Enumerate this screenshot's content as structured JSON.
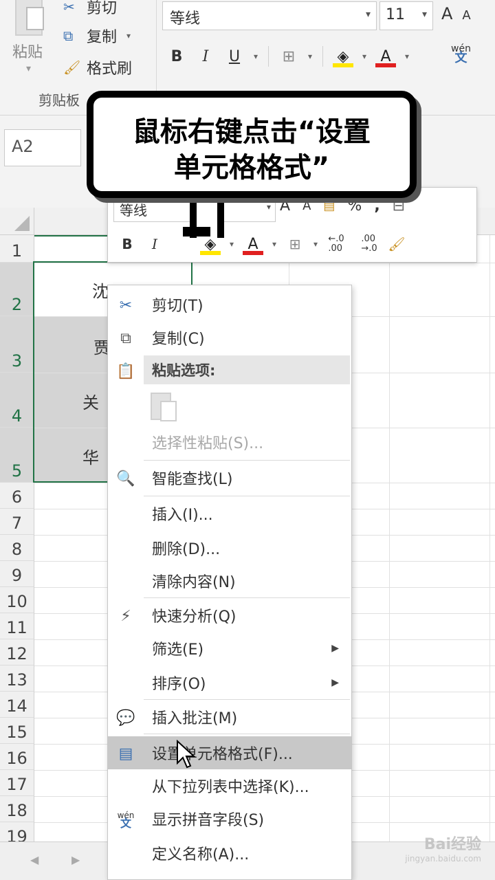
{
  "ribbon": {
    "paste_label": "粘贴",
    "cut_label": "剪切",
    "copy_label": "复制",
    "format_painter_label": "格式刷",
    "clipboard_group_label": "剪贴板",
    "font_name": "等线",
    "font_size": "11",
    "bold": "B",
    "italic": "I",
    "underline": "U",
    "font_color_glyph": "A",
    "phonetic_top": "wén",
    "phonetic_bottom": "文"
  },
  "name_box": "A2",
  "rows": [
    "1",
    "2",
    "3",
    "4",
    "5",
    "6",
    "7",
    "8",
    "9",
    "10",
    "11",
    "12",
    "13",
    "14",
    "15",
    "16",
    "17",
    "18",
    "19"
  ],
  "cells": {
    "a2": "沈",
    "a3": "贾",
    "a4": "关",
    "a5": "华"
  },
  "mini_toolbar": {
    "font_name": "等线",
    "percent": "%",
    "comma": ",",
    "bold": "B",
    "italic": "I",
    "font_color_glyph": "A",
    "increase_decimal": "←.0\n.00",
    "decrease_decimal": ".00\n→.0"
  },
  "context_menu": {
    "cut": "剪切(T)",
    "copy": "复制(C)",
    "paste_options_header": "粘贴选项:",
    "paste_special": "选择性粘贴(S)...",
    "smart_lookup": "智能查找(L)",
    "insert": "插入(I)...",
    "delete": "删除(D)...",
    "clear_contents": "清除内容(N)",
    "quick_analysis": "快速分析(Q)",
    "filter": "筛选(E)",
    "sort": "排序(O)",
    "insert_comment": "插入批注(M)",
    "format_cells": "设置单元格格式(F)...",
    "pick_from_list": "从下拉列表中选择(K)...",
    "show_phonetic": "显示拼音字段(S)",
    "define_name": "定义名称(A)..."
  },
  "callout": {
    "line1": "鼠标右键点击“设置",
    "line2": "单元格格式”"
  },
  "watermark": {
    "brand": "Bai经验",
    "url": "jingyan.baidu.com"
  },
  "colors": {
    "selection_green": "#217346",
    "fill_yellow": "#ffe600",
    "font_red": "#e02020",
    "menu_hover": "#c8c8c8"
  }
}
